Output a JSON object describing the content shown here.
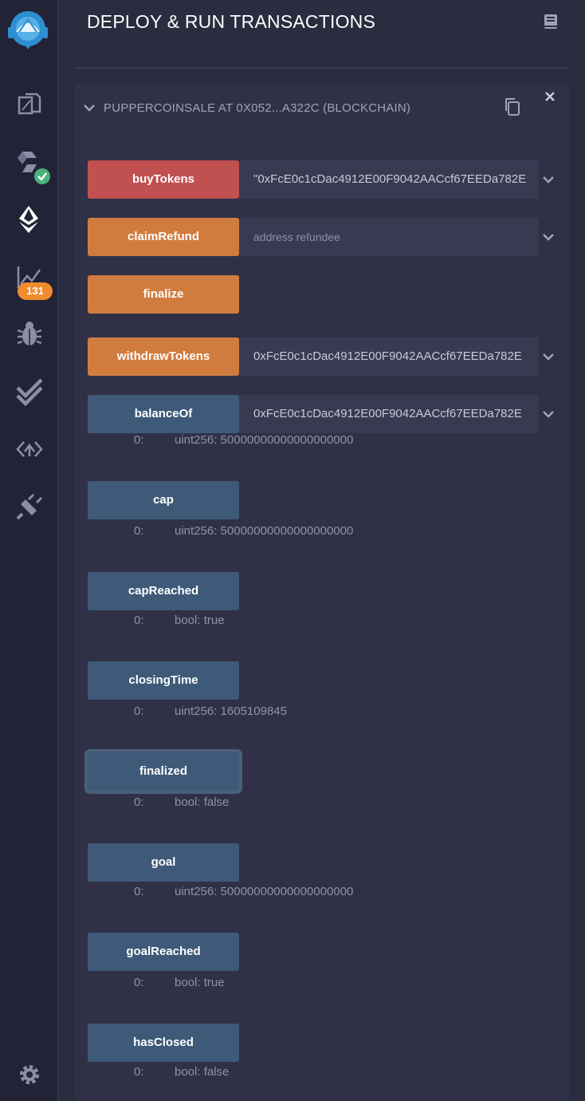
{
  "header": {
    "title": "DEPLOY & RUN TRANSACTIONS"
  },
  "sidebar": {
    "badge_count": "131",
    "icons": [
      "remix-logo-icon",
      "file-explorer-icon",
      "compiler-icon",
      "deploy-icon",
      "analytics-icon",
      "debugger-icon",
      "test-icon",
      "source-verify-icon",
      "plugin-manager-icon",
      "settings-icon"
    ]
  },
  "contract": {
    "title": "PUPPERCOINSALE AT 0X052...A322C (BLOCKCHAIN)"
  },
  "functions": {
    "buyTokens": {
      "label": "buyTokens",
      "value": "\"0xFcE0c1cDac4912E00F9042AACcf67EEDa782E"
    },
    "claimRefund": {
      "label": "claimRefund",
      "placeholder": "address refundee"
    },
    "finalize": {
      "label": "finalize"
    },
    "withdrawTokens": {
      "label": "withdrawTokens",
      "value": "0xFcE0c1cDac4912E00F9042AACcf67EEDa782E"
    },
    "balanceOf": {
      "label": "balanceOf",
      "value": "0xFcE0c1cDac4912E00F9042AACcf67EEDa782E",
      "out_idx": "0:",
      "out_val": "uint256: 50000000000000000000"
    },
    "cap": {
      "label": "cap",
      "out_idx": "0:",
      "out_val": "uint256: 50000000000000000000"
    },
    "capReached": {
      "label": "capReached",
      "out_idx": "0:",
      "out_val": "bool: true"
    },
    "closingTime": {
      "label": "closingTime",
      "out_idx": "0:",
      "out_val": "uint256: 1605109845"
    },
    "finalized": {
      "label": "finalized",
      "out_idx": "0:",
      "out_val": "bool: false"
    },
    "goal": {
      "label": "goal",
      "out_idx": "0:",
      "out_val": "uint256: 50000000000000000000"
    },
    "goalReached": {
      "label": "goalReached",
      "out_idx": "0:",
      "out_val": "bool: true"
    },
    "hasClosed": {
      "label": "hasClosed",
      "out_idx": "0:",
      "out_val": "bool: false"
    }
  },
  "colors": {
    "payable": "#c15050",
    "transact": "#d17c3f",
    "call": "#3e5a78",
    "badge": "#f08c2e"
  }
}
